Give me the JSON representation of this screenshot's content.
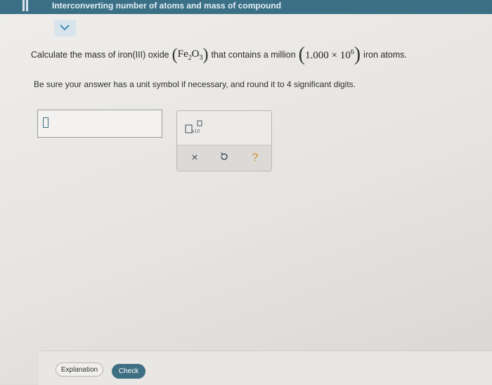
{
  "header": {
    "title": "Interconverting number of atoms and mass of compound"
  },
  "question": {
    "part1": "Calculate the mass of iron(III) oxide",
    "formula_fe": "Fe",
    "formula_sub1": "2",
    "formula_o": "O",
    "formula_sub2": "3",
    "part2": "that contains a million",
    "number_mantissa": "1.000",
    "times": "×",
    "number_base": "10",
    "number_exp": "6",
    "part3": "iron atoms."
  },
  "instruction": "Be sure your answer has a unit symbol if necessary, and round it to 4 significant digits.",
  "answer": {
    "value": ""
  },
  "tools": {
    "scientific_notation_icon": "x10-icon",
    "clear_label": "×",
    "undo_icon": "undo-icon",
    "help_label": "?"
  },
  "footer": {
    "explanation_label": "Explanation",
    "check_label": "Check"
  },
  "colors": {
    "topbar": "#3b6f86",
    "check_button": "#3e6f83"
  }
}
